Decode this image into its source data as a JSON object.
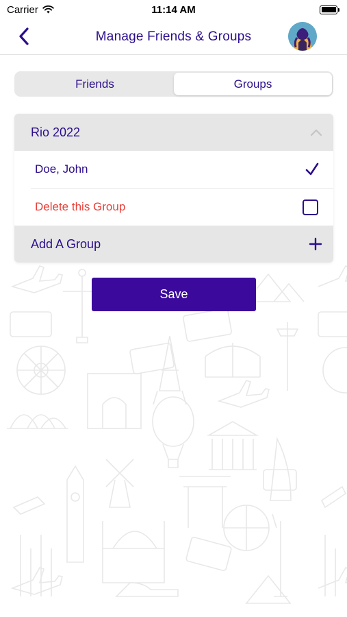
{
  "status_bar": {
    "carrier": "Carrier",
    "time": "11:14 AM"
  },
  "nav": {
    "title": "Manage Friends & Groups",
    "back_icon": "chevron-left-icon",
    "avatar_icon": "avatar"
  },
  "tabs": [
    {
      "label": "Friends",
      "selected": false
    },
    {
      "label": "Groups",
      "selected": true
    }
  ],
  "group": {
    "name": "Rio 2022",
    "expanded": true,
    "members": [
      {
        "name": "Doe, John",
        "checked": true
      }
    ],
    "delete_label": "Delete this Group",
    "delete_checked": false
  },
  "add_group": {
    "label": "Add A Group"
  },
  "save_label": "Save",
  "colors": {
    "accent": "#2b0d8c",
    "button": "#3b0a9c",
    "danger": "#e8403a",
    "section_bg": "#e6e6e6"
  }
}
